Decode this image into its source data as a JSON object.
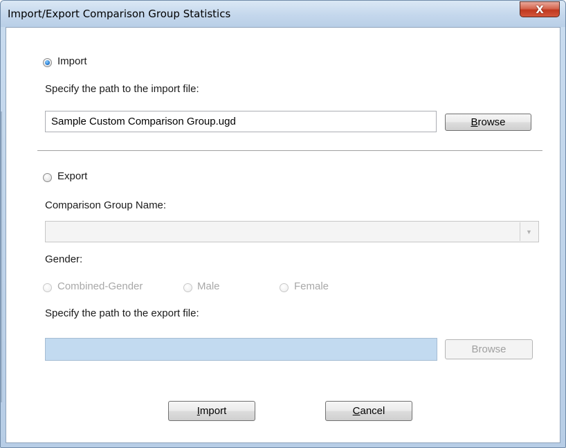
{
  "window": {
    "title": "Import/Export Comparison Group Statistics",
    "close_glyph": "X"
  },
  "import": {
    "radio_label": "Import",
    "selected": true,
    "path_label": "Specify the path to the import file:",
    "path_value": "Sample Custom Comparison Group.ugd",
    "browse_prefix": "",
    "browse_mnemonic": "B",
    "browse_rest": "rowse"
  },
  "export": {
    "radio_label": "Export",
    "selected": false,
    "group_name_label": "Comparison Group Name:",
    "group_name_value": "",
    "gender_label": "Gender:",
    "gender_options": [
      "Combined-Gender",
      "Male",
      "Female"
    ],
    "path_label": "Specify the path to the export file:",
    "path_value": "",
    "browse_label": "Browse"
  },
  "footer": {
    "import_mnemonic": "I",
    "import_rest": "mport",
    "cancel_mnemonic": "C",
    "cancel_rest": "ancel"
  },
  "colors": {
    "title_gradient_top": "#dbe8f5",
    "close_red": "#c0391f",
    "disabled_field_blue": "#c2daf0"
  }
}
